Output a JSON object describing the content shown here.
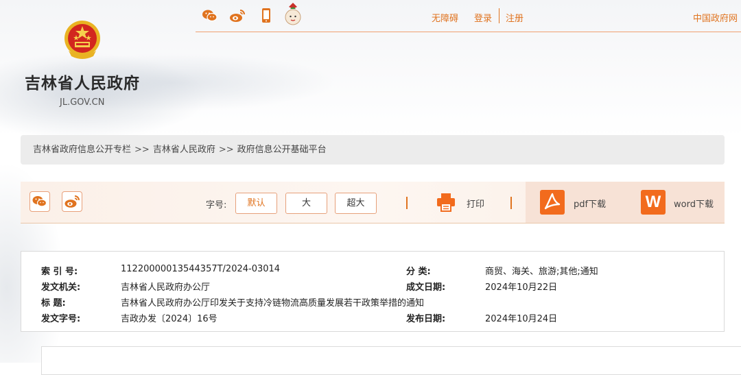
{
  "header": {
    "site_title": "吉林省人民政府",
    "site_domain": "JL.GOV.CN",
    "top_links": {
      "accessibility": "无障碍",
      "login": "登录",
      "register": "注册",
      "china_gov": "中国政府网"
    },
    "top_icons": [
      "wechat-icon",
      "weibo-icon",
      "mobile-icon",
      "mascot-icon"
    ]
  },
  "breadcrumb": {
    "items": [
      "吉林省政府信息公开专栏",
      "吉林省人民政府",
      "政府信息公开基础平台"
    ],
    "separator": ">>"
  },
  "toolbar": {
    "font_size_label": "字号:",
    "font_sizes": [
      "默认",
      "大",
      "超大"
    ],
    "print_label": "打印",
    "pdf_label": "pdf下载",
    "word_label": "word下载",
    "word_icon_letter": "W"
  },
  "info": {
    "index_no_label": "索 引 号:",
    "index_no": "11220000013544357T/2024-03014",
    "category_label": "分 类:",
    "category": "商贸、海关、旅游;其他;通知",
    "issuer_label": "发文机关:",
    "issuer": "吉林省人民政府办公厅",
    "written_date_label": "成文日期:",
    "written_date": "2024年10月22日",
    "title_label": "标 题:",
    "title": "吉林省人民政府办公厅印发关于支持冷链物流高质量发展若干政策举措的通知",
    "doc_no_label": "发文字号:",
    "doc_no": "吉政办发〔2024〕16号",
    "publish_date_label": "发布日期:",
    "publish_date": "2024年10月24日"
  },
  "colors": {
    "accent": "#e0731f",
    "download_orange": "#f26b1d",
    "breadcrumb_bg": "#ececec"
  }
}
